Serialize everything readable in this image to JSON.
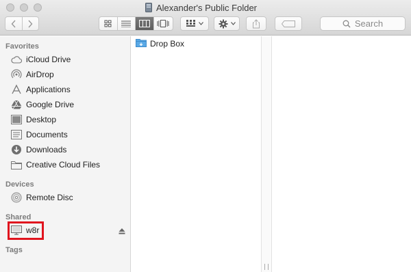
{
  "window": {
    "title": "Alexander's Public Folder"
  },
  "toolbar": {
    "search_placeholder": "Search"
  },
  "sidebar": {
    "favorites_header": "Favorites",
    "favorites": [
      {
        "label": "iCloud Drive",
        "icon": "cloud-icon"
      },
      {
        "label": "AirDrop",
        "icon": "airdrop-icon"
      },
      {
        "label": "Applications",
        "icon": "applications-icon"
      },
      {
        "label": "Google Drive",
        "icon": "google-drive-icon"
      },
      {
        "label": "Desktop",
        "icon": "desktop-icon"
      },
      {
        "label": "Documents",
        "icon": "documents-icon"
      },
      {
        "label": "Downloads",
        "icon": "downloads-icon"
      },
      {
        "label": "Creative Cloud Files",
        "icon": "folder-icon"
      }
    ],
    "devices_header": "Devices",
    "devices": [
      {
        "label": "Remote Disc",
        "icon": "disc-icon"
      }
    ],
    "shared_header": "Shared",
    "shared": [
      {
        "label": "w8r",
        "icon": "computer-icon"
      }
    ],
    "tags_header": "Tags"
  },
  "content": {
    "column1_items": [
      {
        "label": "Drop Box",
        "icon": "dropbox-folder-icon"
      }
    ]
  },
  "colors": {
    "highlight": "#e0141e",
    "folder": "#5aa9e6",
    "active_segment": "#666666"
  }
}
